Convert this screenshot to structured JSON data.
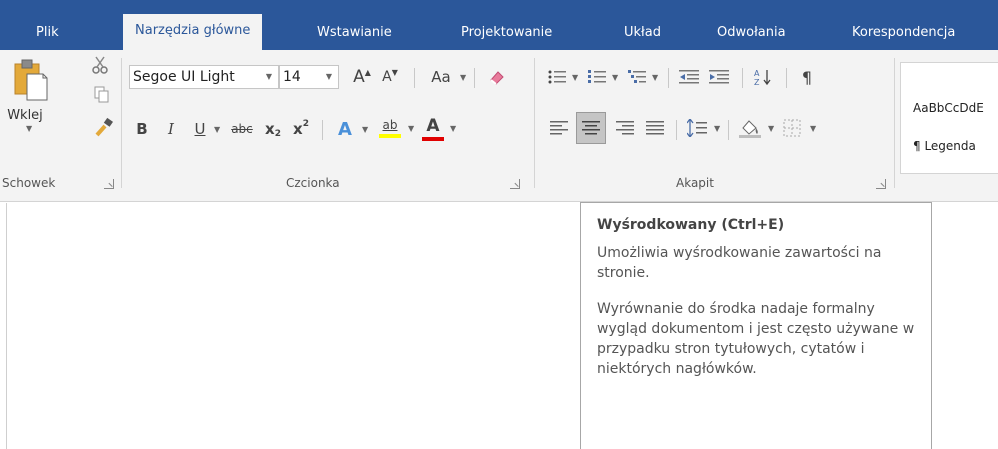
{
  "tabs": [
    {
      "label": "Plik"
    },
    {
      "label": "Narzędzia główne"
    },
    {
      "label": "Wstawianie"
    },
    {
      "label": "Projektowanie"
    },
    {
      "label": "Układ"
    },
    {
      "label": "Odwołania"
    },
    {
      "label": "Korespondencja"
    }
  ],
  "active_tab": "Narzędzia główne",
  "clipboard": {
    "paste_label": "Wklej",
    "group_label": "Schowek"
  },
  "font": {
    "name": "Segoe UI Light",
    "size": "14",
    "group_label": "Czcionka",
    "grow_label": "A",
    "shrink_label": "A",
    "case_label": "Aa",
    "bold_label": "B",
    "italic_label": "I",
    "underline_label": "U",
    "strike_label": "abc",
    "subscript_label": "x",
    "superscript_label": "x",
    "effects_label": "A",
    "highlight_label": "ab",
    "color_label": "A"
  },
  "paragraph": {
    "group_label": "Akapit",
    "pilcrow_label": "¶"
  },
  "styles": {
    "items": [
      "AaBbCcDdE",
      "¶ Legenda"
    ]
  },
  "tooltip": {
    "title": "Wyśrodkowany (Ctrl+E)",
    "paragraph1": "Umożliwia wyśrodkowanie zawartości na stronie.",
    "paragraph2": "Wyrównanie do środka nadaje formalny wygląd dokumentom i jest często używane w przypadku stron tytułowych, cytatów i niektórych nagłówków."
  },
  "colors": {
    "tab_bar": "#2b579a",
    "ribbon": "#f3f3f3",
    "highlight_yellow": "#ffff00",
    "font_red": "#e00000",
    "selected_button": "#c5c5c5"
  },
  "icons": [
    "paste-icon",
    "cut-icon",
    "copy-icon",
    "format-painter-icon",
    "bullets-icon",
    "numbering-icon",
    "multilevel-list-icon",
    "decrease-indent-icon",
    "increase-indent-icon",
    "sort-icon",
    "align-left-icon",
    "align-center-icon",
    "align-right-icon",
    "justify-icon",
    "line-spacing-icon",
    "shading-icon",
    "borders-icon",
    "clear-formatting-icon",
    "mouse-pointer-icon"
  ]
}
